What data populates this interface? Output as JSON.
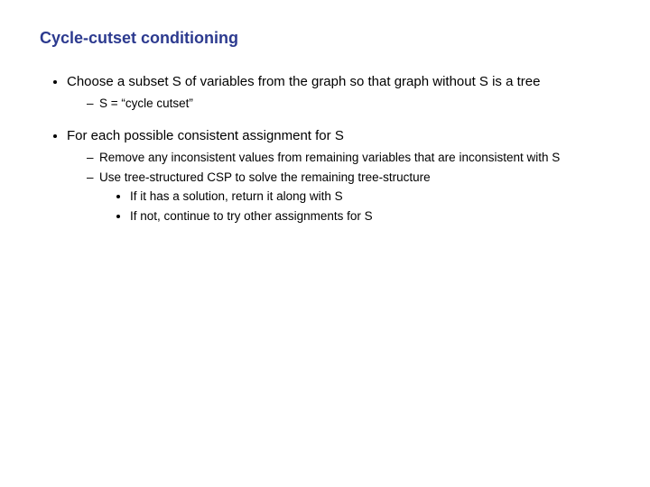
{
  "title": "Cycle-cutset conditioning",
  "bullets": [
    {
      "lead": "Choose a subset S of variables from the graph so that graph without S is a tree",
      "sub": [
        {
          "text": "S = “cycle cutset”"
        }
      ]
    },
    {
      "lead": "For each possible consistent assignment for S",
      "sub": [
        {
          "text": "Remove any inconsistent values from remaining variables that are inconsistent with S"
        },
        {
          "text": "Use tree-structured CSP to solve the remaining tree-structure",
          "subsub": [
            "If it has a solution, return it along with S",
            "If not, continue to try other assignments for S"
          ]
        }
      ]
    }
  ]
}
